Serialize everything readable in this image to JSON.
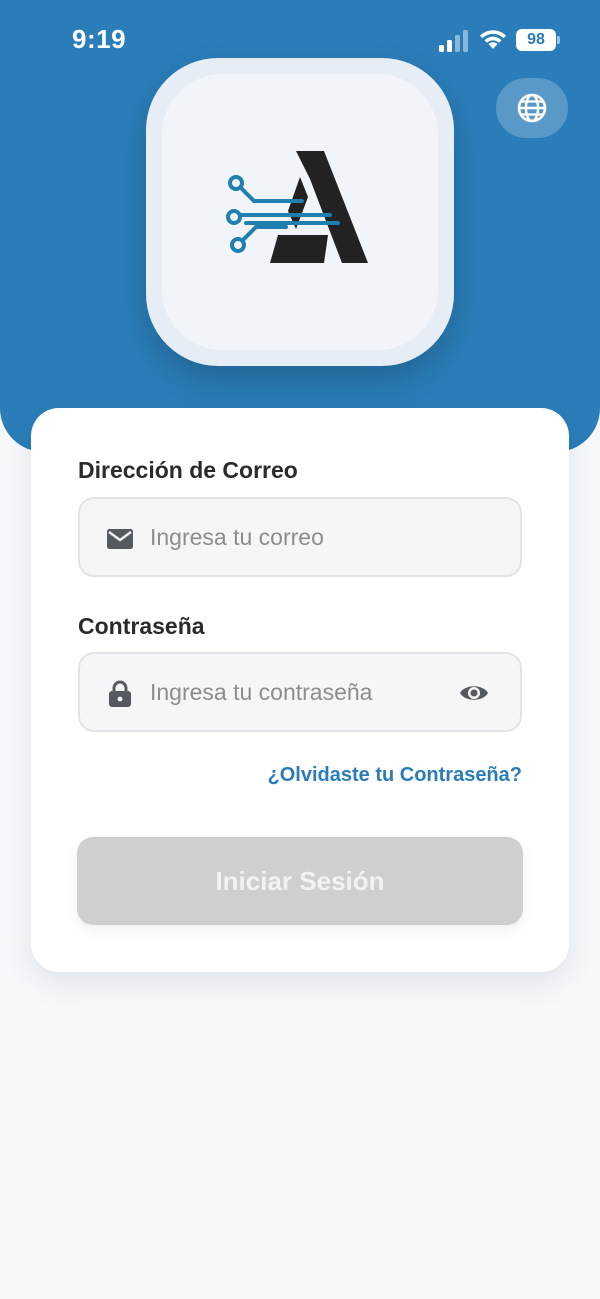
{
  "status_bar": {
    "time": "9:19",
    "battery": "98",
    "icons": [
      "signal-icon",
      "wifi-icon",
      "battery-icon"
    ]
  },
  "header": {
    "language_button_icon": "globe-icon",
    "logo_icon": "circuit-a-logo",
    "colors": {
      "header_bg": "#2a7db8",
      "logo_circuit": "#1f7fb0",
      "logo_letter": "#222222"
    }
  },
  "form": {
    "email": {
      "label": "Dirección de Correo",
      "placeholder": "Ingresa tu correo",
      "value": "",
      "icon": "mail-icon"
    },
    "password": {
      "label": "Contraseña",
      "placeholder": "Ingresa tu contraseña",
      "value": "",
      "icon": "lock-icon",
      "toggle_icon": "eye-icon"
    },
    "forgot_password": "¿Olvidaste tu Contraseña?",
    "submit_label": "Iniciar Sesión",
    "colors": {
      "link": "#2a7db8",
      "button_disabled_bg": "#cfcfcf",
      "button_text": "#f2f2f2"
    }
  }
}
